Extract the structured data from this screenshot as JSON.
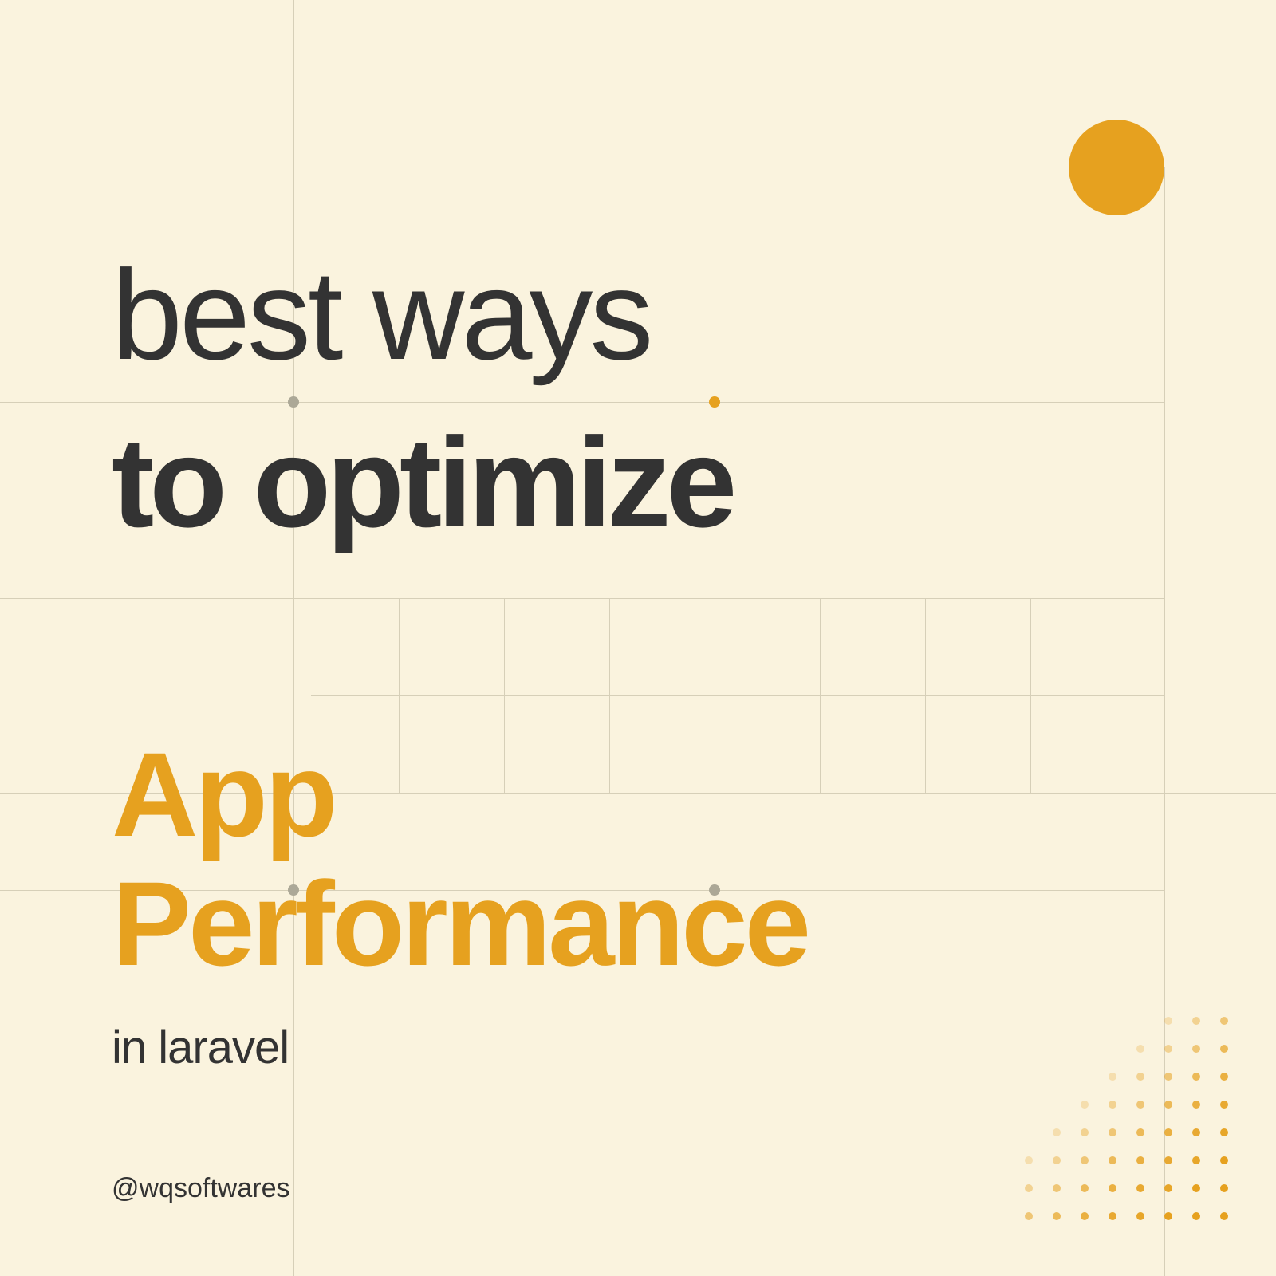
{
  "heading": {
    "line1": "best ways",
    "line2": "to optimize",
    "line3a": "App",
    "line3b": "Performance",
    "sub": "in laravel"
  },
  "handle": "@wqsoftwares",
  "colors": {
    "accent": "#e6a11f",
    "dark": "#333333",
    "bg": "#faf3de",
    "grid": "#d6cfb8",
    "gray": "#aca897"
  }
}
